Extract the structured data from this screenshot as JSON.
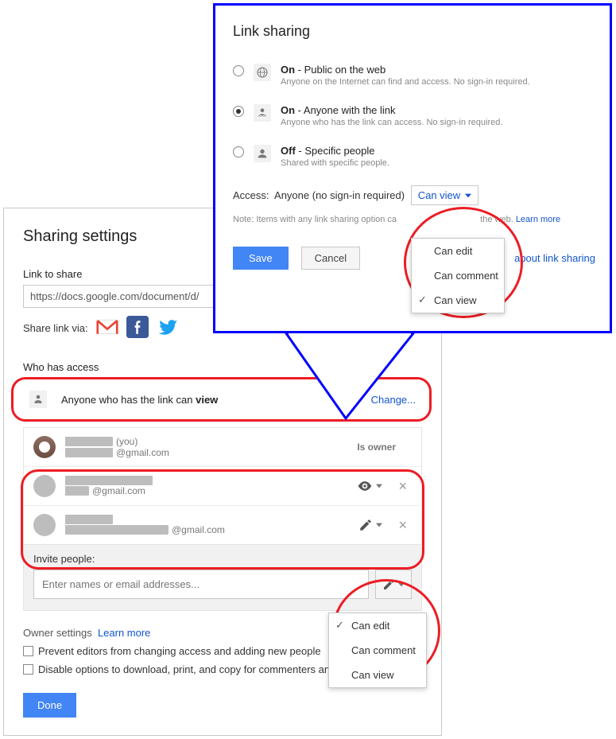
{
  "sharing": {
    "title": "Sharing settings",
    "link_label": "Link to share",
    "link_value": "https://docs.google.com/document/d/",
    "share_via_label": "Share link via:",
    "who_has_access": "Who has access",
    "access_row_prefix": "Anyone who has the link can ",
    "access_row_bold": "view",
    "change": "Change...",
    "people": [
      {
        "you_suffix": "(you)",
        "email_suffix": "@gmail.com",
        "role": "Is owner"
      },
      {
        "email_suffix": "@gmail.com",
        "perm_icon": "eye"
      },
      {
        "email_suffix": "@gmail.com",
        "perm_icon": "pencil"
      }
    ],
    "invite_label": "Invite people:",
    "invite_placeholder": "Enter names or email addresses...",
    "owner_settings": "Owner settings",
    "learn_more": "Learn more",
    "chk1": "Prevent editors from changing access and adding new people",
    "chk2": "Disable options to download, print, and copy for commenters and viewers",
    "done": "Done"
  },
  "link_sharing": {
    "title": "Link sharing",
    "options": [
      {
        "bold": "On",
        "rest": " - Public on the web",
        "sub": "Anyone on the Internet can find and access. No sign-in required.",
        "icon": "globe",
        "selected": false
      },
      {
        "bold": "On",
        "rest": " - Anyone with the link",
        "sub": "Anyone who has the link can access. No sign-in required.",
        "icon": "link",
        "selected": true
      },
      {
        "bold": "Off",
        "rest": " - Specific people",
        "sub": "Shared with specific people.",
        "icon": "person",
        "selected": false
      }
    ],
    "access_label": "Access:",
    "access_who": "Anyone (no sign-in required)",
    "access_value": "Can view",
    "note_prefix": "Note: Items with any link sharing option ca",
    "note_suffix": "the web. ",
    "learn_more": "Learn more",
    "save": "Save",
    "cancel": "Cancel",
    "learn_about": "about link sharing",
    "dropdown1": {
      "items": [
        "Can edit",
        "Can comment",
        "Can view"
      ],
      "checked": "Can view"
    },
    "dropdown2": {
      "items": [
        "Can edit",
        "Can comment",
        "Can view"
      ],
      "checked": "Can edit"
    }
  }
}
